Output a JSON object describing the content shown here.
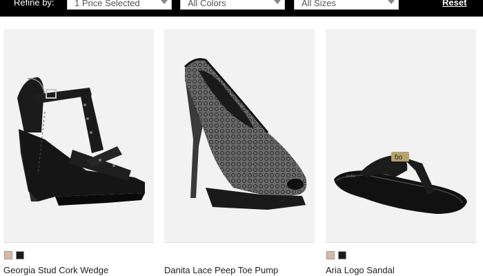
{
  "filters": {
    "refine_label": "Refine by:",
    "price": "1 Price Selected",
    "color": "All Colors",
    "size": "All Sizes",
    "reset": "Reset"
  },
  "products": [
    {
      "name": "Georgia Stud Cork Wedge",
      "swatches": [
        "nude",
        "black"
      ]
    },
    {
      "name": "Danita Lace Peep Toe Pump",
      "swatches": []
    },
    {
      "name": "Aria Logo Sandal",
      "swatches": [
        "nude",
        "black"
      ]
    }
  ],
  "colors": {
    "bar": "#000000",
    "nude_swatch": "#d9b8a2",
    "black_swatch": "#1a1a1a"
  }
}
